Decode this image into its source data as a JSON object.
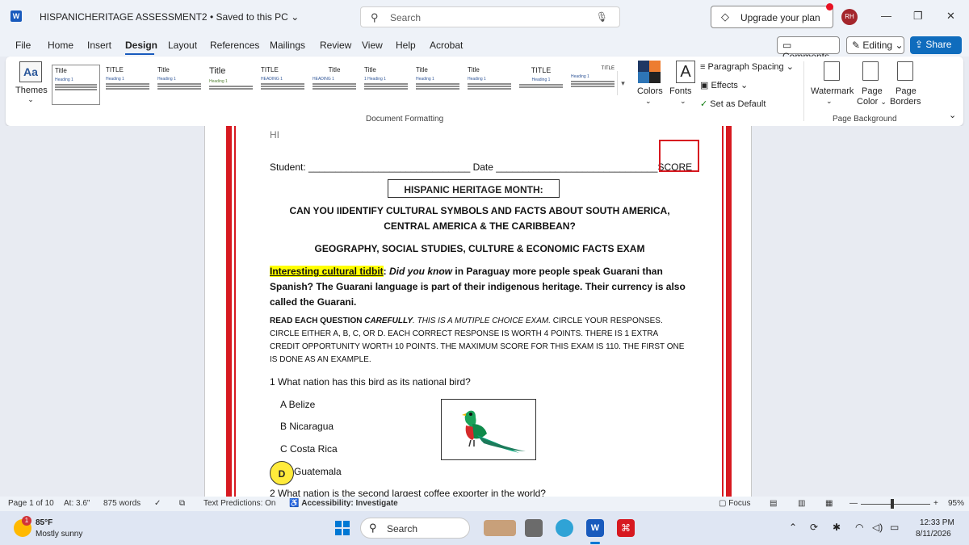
{
  "window": {
    "doc_title": "HISPANICHERITAGE ASSESSMENT2 • Saved to this PC",
    "search_placeholder": "Search",
    "upgrade_label": "Upgrade your plan",
    "avatar_initials": "RH"
  },
  "menu": {
    "items": [
      "File",
      "Home",
      "Insert",
      "Design",
      "Layout",
      "References",
      "Mailings",
      "Review",
      "View",
      "Help",
      "Acrobat"
    ],
    "comments_label": "Comments",
    "editing_label": "Editing",
    "share_label": "Share"
  },
  "ribbon": {
    "themes_label": "Themes",
    "style_sets": [
      {
        "title": "Title",
        "heading": "Heading 1"
      },
      {
        "title": "TITLE",
        "heading": "Heading 1"
      },
      {
        "title": "Title",
        "heading": "Heading 1"
      },
      {
        "title": "Title",
        "heading": "Heading 1"
      },
      {
        "title": "TITLE",
        "heading": "HEADING 1"
      },
      {
        "title": "Title",
        "heading": "HEADING 1"
      },
      {
        "title": "Title",
        "heading": "1 Heading 1"
      },
      {
        "title": "Title",
        "heading": "Heading 1"
      },
      {
        "title": "Title",
        "heading": "Heading 1"
      },
      {
        "title": "TITLE",
        "heading": "Heading 1"
      },
      {
        "title": "TITLE",
        "heading": "Heading 1"
      }
    ],
    "colors_label": "Colors",
    "fonts_label": "Fonts",
    "paragraph_spacing_label": "Paragraph Spacing",
    "effects_label": "Effects",
    "set_default_label": "Set as Default",
    "document_formatting_label": "Document Formatting",
    "watermark_label": "Watermark",
    "page_color_label": "Page Color",
    "page_borders_label": "Page Borders",
    "page_color_line1": "Page",
    "page_color_line2": "Color",
    "page_borders_line1": "Page",
    "page_borders_line2": "Borders",
    "page_background_label": "Page Background"
  },
  "document": {
    "hi": "HI",
    "student_label": "Student: ______________________________ Date ______________________________SCORE",
    "banner": "HISPANIC HERITAGE MONTH:",
    "subtitle_line1": "CAN YOU IIDENTIFY CULTURAL SYMBOLS AND FACTS ABOUT SOUTH AMERICA,",
    "subtitle_line2": "CENTRAL AMERICA & THE CARIBBEAN?",
    "exam_title": "GEOGRAPHY, SOCIAL STUDIES, CULTURE & ECONOMIC FACTS EXAM",
    "tidbit_label": "Interesting  cultural tidbit",
    "tidbit_colon": ":",
    "tidbit_italic": "Did you know",
    "tidbit_rest": "in Paraguay more people speak Guarani than Spanish?  The Guarani language is part of their indigenous heritage.  Their currency is also called the Guarani.",
    "instr_bold": "READ EACH QUESTION",
    "instr_italic_bold": "CAREFULLY",
    "instr_italic": ".  THIS IS A MUTIPLE CHOICE EXAM.",
    "instr_rest": "  CIRCLE YOUR RESPONSES.  CIRCLE EITHER A, B, C, OR D.  EACH CORRECT RESPONSE IS WORTH 4 POINTS.  THERE IS 1 EXTRA CREDIT OPPORTUNITY WORTH 10 POINTS. THE MAXIMUM SCORE FOR THIS EXAM IS 110. THE FIRST ONE IS DONE AS AN EXAMPLE.",
    "question1": "1 What nation has this bird as its national bird?",
    "options": [
      "A  Belize",
      "B Nicaragua",
      "C Costa Rica"
    ],
    "answer_letter": "D",
    "answer_text": "Guatemala",
    "question2": "2 What nation is the second largest coffee exporter in the world?"
  },
  "status": {
    "page": "Page 1 of 10",
    "at": "At: 3.6\"",
    "words": "875 words",
    "predictions": "Text Predictions: On",
    "accessibility": "Accessibility: Investigate",
    "focus": "Focus",
    "zoom": "95%"
  },
  "taskbar": {
    "temperature": "85°F",
    "weather": "Mostly sunny",
    "badge": "1",
    "search_label": "Search",
    "time": "12:33 PM",
    "date": "8/11/2026"
  }
}
